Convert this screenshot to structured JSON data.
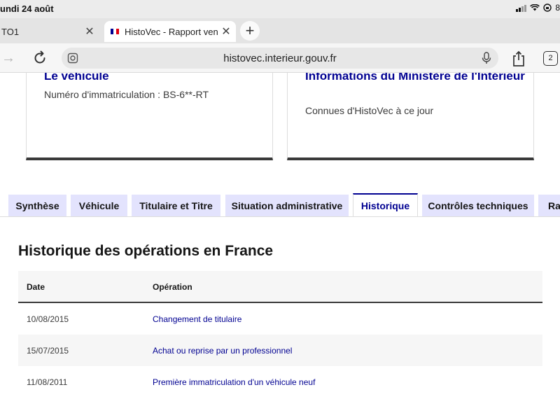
{
  "status_bar": {
    "time": "undi 24 août",
    "battery": "8"
  },
  "browser": {
    "tabs": [
      {
        "label": "TO1",
        "active": false
      },
      {
        "label": "HistoVec - Rapport vendeur",
        "active": true
      }
    ],
    "url": "histovec.interieur.gouv.fr",
    "tab_count": "2"
  },
  "cards": [
    {
      "title": "Le véhicule",
      "text": "Numéro d'immatriculation : BS-6**-RT"
    },
    {
      "title": "Informations du Ministère de l'Intérieur",
      "text": "Connues d'HistoVec à ce jour"
    }
  ],
  "section_tabs": [
    {
      "label": "Synthèse",
      "active": false
    },
    {
      "label": "Véhicule",
      "active": false
    },
    {
      "label": "Titulaire et Titre",
      "active": false
    },
    {
      "label": "Situation administrative",
      "active": false
    },
    {
      "label": "Historique",
      "active": true
    },
    {
      "label": "Contrôles techniques",
      "active": false
    },
    {
      "label": "Rap",
      "active": false
    }
  ],
  "panel": {
    "title": "Historique des opérations en France",
    "columns": [
      "Date",
      "Opération"
    ],
    "rows": [
      {
        "date": "10/08/2015",
        "operation": "Changement de titulaire"
      },
      {
        "date": "15/07/2015",
        "operation": "Achat ou reprise par un professionnel"
      },
      {
        "date": "11/08/2011",
        "operation": "Première immatriculation d'un véhicule neuf"
      }
    ]
  },
  "colors": {
    "accent": "#000091",
    "tab_background": "#e3e3fd",
    "table_stripe": "#f6f6f6"
  }
}
